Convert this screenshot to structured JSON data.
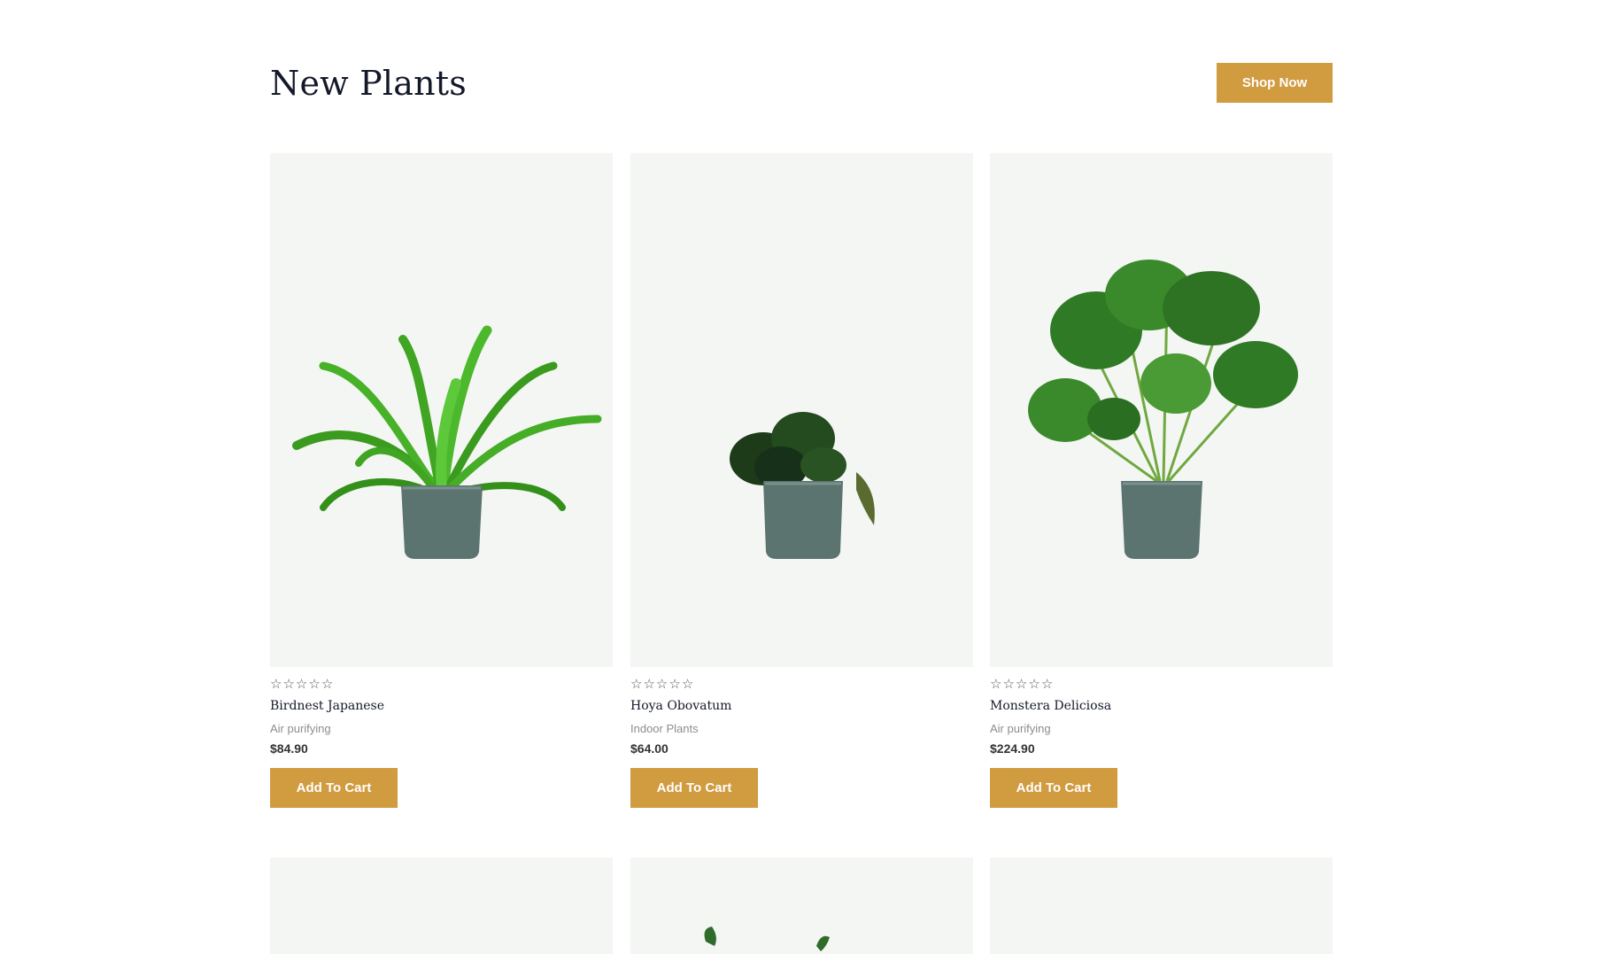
{
  "section": {
    "title": "New Plants",
    "shop_now_label": "Shop Now"
  },
  "products": [
    {
      "name": "Birdnest Japanese",
      "category": "Air purifying",
      "price": "$84.90",
      "button": "Add To Cart",
      "rating": 0,
      "rating_max": 5
    },
    {
      "name": "Hoya Obovatum",
      "category": "Indoor Plants",
      "price": "$64.00",
      "button": "Add To Cart",
      "rating": 0,
      "rating_max": 5
    },
    {
      "name": "Monstera Deliciosa",
      "category": "Air purifying",
      "price": "$224.90",
      "button": "Add To Cart",
      "rating": 0,
      "rating_max": 5
    }
  ],
  "colors": {
    "accent": "#d19b40",
    "card_bg": "#f4f6f3",
    "pot": "#5b7470",
    "heading": "#14192a"
  }
}
